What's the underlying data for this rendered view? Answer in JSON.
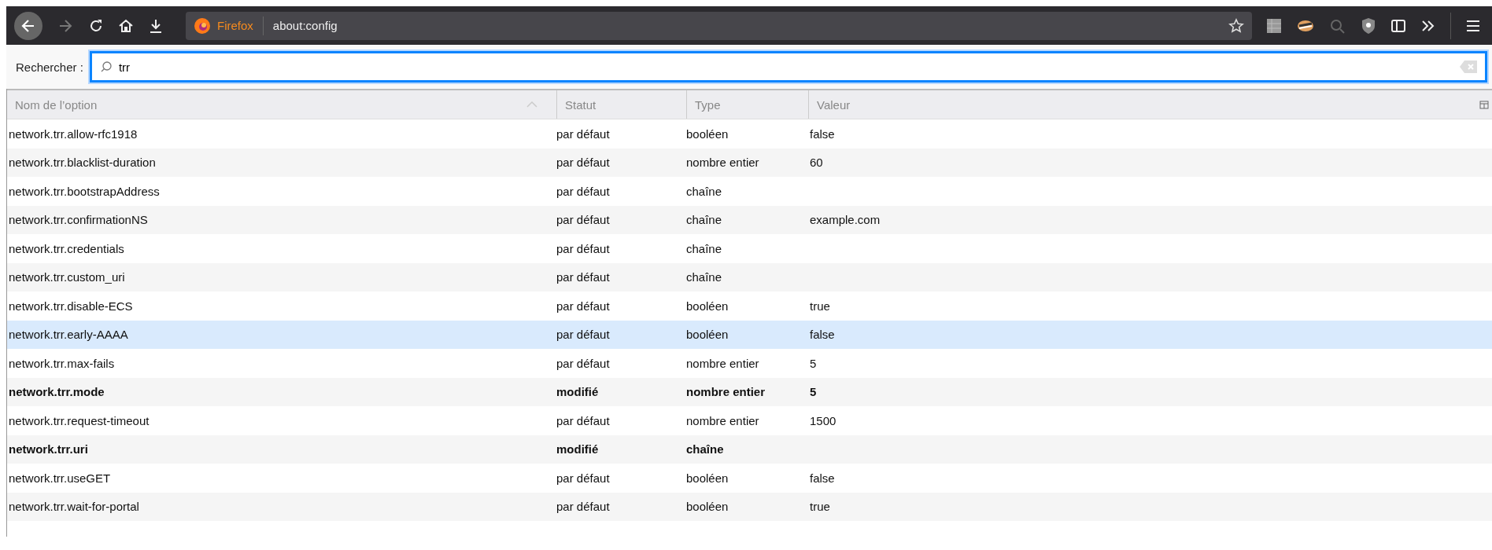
{
  "toolbar": {
    "identity_label": "Firefox",
    "address": "about:config"
  },
  "search": {
    "label": "Rechercher :",
    "value": "trr"
  },
  "table": {
    "columns": [
      "Nom de l’option",
      "Statut",
      "Type",
      "Valeur"
    ],
    "rows": [
      {
        "name": "network.trr.allow-rfc1918",
        "status": "par défaut",
        "type": "booléen",
        "value": "false",
        "modified": false,
        "selected": false
      },
      {
        "name": "network.trr.blacklist-duration",
        "status": "par défaut",
        "type": "nombre entier",
        "value": "60",
        "modified": false,
        "selected": false
      },
      {
        "name": "network.trr.bootstrapAddress",
        "status": "par défaut",
        "type": "chaîne",
        "modified": false,
        "selected": false
      },
      {
        "name": "network.trr.confirmationNS",
        "status": "par défaut",
        "type": "chaîne",
        "value": "example.com",
        "modified": false,
        "selected": false
      },
      {
        "name": "network.trr.credentials",
        "status": "par défaut",
        "type": "chaîne",
        "modified": false,
        "selected": false
      },
      {
        "name": "network.trr.custom_uri",
        "status": "par défaut",
        "type": "chaîne",
        "modified": false,
        "selected": false
      },
      {
        "name": "network.trr.disable-ECS",
        "status": "par défaut",
        "type": "booléen",
        "value": "true",
        "modified": false,
        "selected": false
      },
      {
        "name": "network.trr.early-AAAA",
        "status": "par défaut",
        "type": "booléen",
        "value": "false",
        "modified": false,
        "selected": true
      },
      {
        "name": "network.trr.max-fails",
        "status": "par défaut",
        "type": "nombre entier",
        "value": "5",
        "modified": false,
        "selected": false
      },
      {
        "name": "network.trr.mode",
        "status": "modifié",
        "type": "nombre entier",
        "value": "5",
        "modified": true,
        "selected": false
      },
      {
        "name": "network.trr.request-timeout",
        "status": "par défaut",
        "type": "nombre entier",
        "value": "1500",
        "modified": false,
        "selected": false
      },
      {
        "name": "network.trr.uri",
        "status": "modifié",
        "type": "chaîne",
        "modified": true,
        "selected": false
      },
      {
        "name": "network.trr.useGET",
        "status": "par défaut",
        "type": "booléen",
        "value": "false",
        "modified": false,
        "selected": false
      },
      {
        "name": "network.trr.wait-for-portal",
        "status": "par défaut",
        "type": "booléen",
        "value": "true",
        "modified": false,
        "selected": false
      }
    ]
  }
}
